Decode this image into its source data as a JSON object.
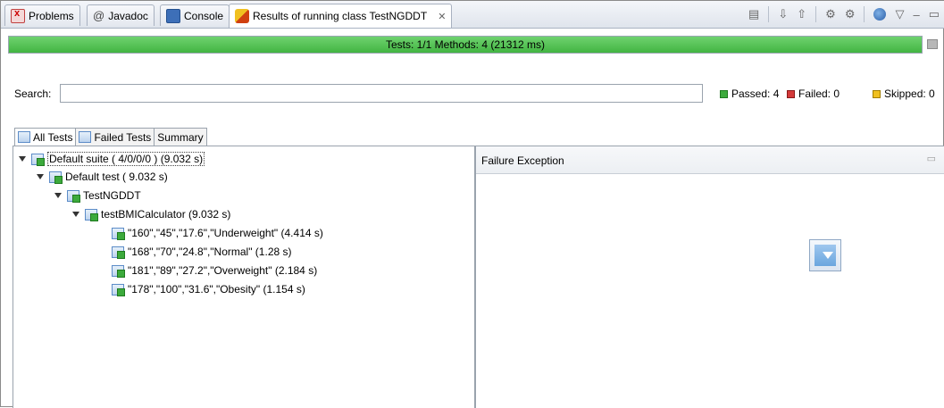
{
  "tabs": [
    {
      "label": "Problems",
      "icon": "problems-icon"
    },
    {
      "label": "Javadoc",
      "icon": "at-icon"
    },
    {
      "label": "Console",
      "icon": "console-icon"
    },
    {
      "label": "Results of running class TestNGDDT",
      "icon": "testng-icon",
      "active": true
    }
  ],
  "progress": {
    "label": "Tests: 1/1  Methods: 4 (21312 ms)",
    "fraction": 1.0,
    "color": "#42b542"
  },
  "search": {
    "label": "Search:",
    "value": ""
  },
  "counts": {
    "passed": "Passed: 4",
    "failed": "Failed: 0",
    "skipped": "Skipped: 0"
  },
  "lower_tabs": [
    {
      "label": "All Tests",
      "active": true
    },
    {
      "label": "Failed Tests",
      "active": false
    },
    {
      "label": "Summary",
      "active": false
    }
  ],
  "tree": {
    "suite": "Default suite ( 4/0/0/0 ) (9.032 s)",
    "test": "Default test ( 9.032 s)",
    "class": "TestNGDDT",
    "method": "testBMICalculator  (9.032 s)",
    "invocations": [
      "\"160\",\"45\",\"17.6\",\"Underweight\"  (4.414 s)",
      "\"168\",\"70\",\"24.8\",\"Normal\"  (1.28 s)",
      "\"181\",\"89\",\"27.2\",\"Overweight\"  (2.184 s)",
      "\"178\",\"100\",\"31.6\",\"Obesity\"  (1.154 s)"
    ]
  },
  "failure_panel": {
    "title": "Failure Exception"
  }
}
